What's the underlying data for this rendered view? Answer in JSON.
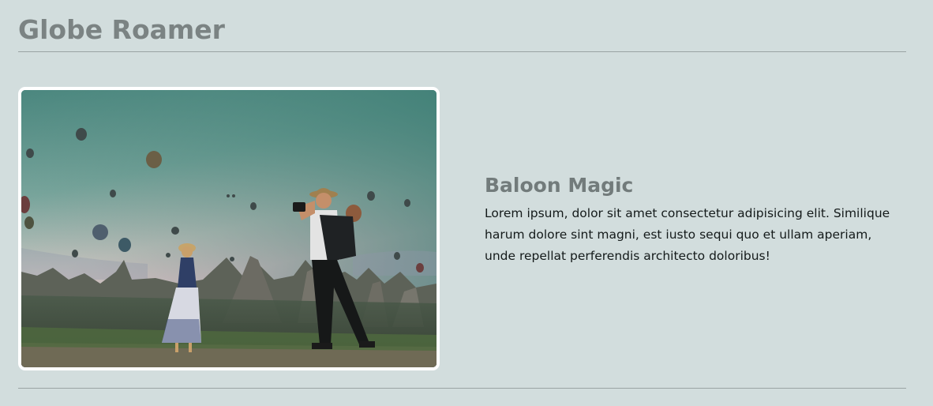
{
  "header": {
    "title": "Globe Roamer"
  },
  "feature": {
    "image_alt": "Hot air balloons over rock formations with a photographer and a woman",
    "heading": "Baloon Magic",
    "body": "Lorem ipsum, dolor sit amet consectetur adipisicing elit. Similique harum dolore sint magni, est iusto sequi quo et ullam aperiam, unde repellat perferendis architecto doloribus!"
  },
  "colors": {
    "background": "#d2dddd",
    "title": "#7b8383",
    "heading": "#727b7b",
    "text": "#141a1a",
    "rule": "#9aa3a3",
    "image_border": "#ffffff"
  }
}
